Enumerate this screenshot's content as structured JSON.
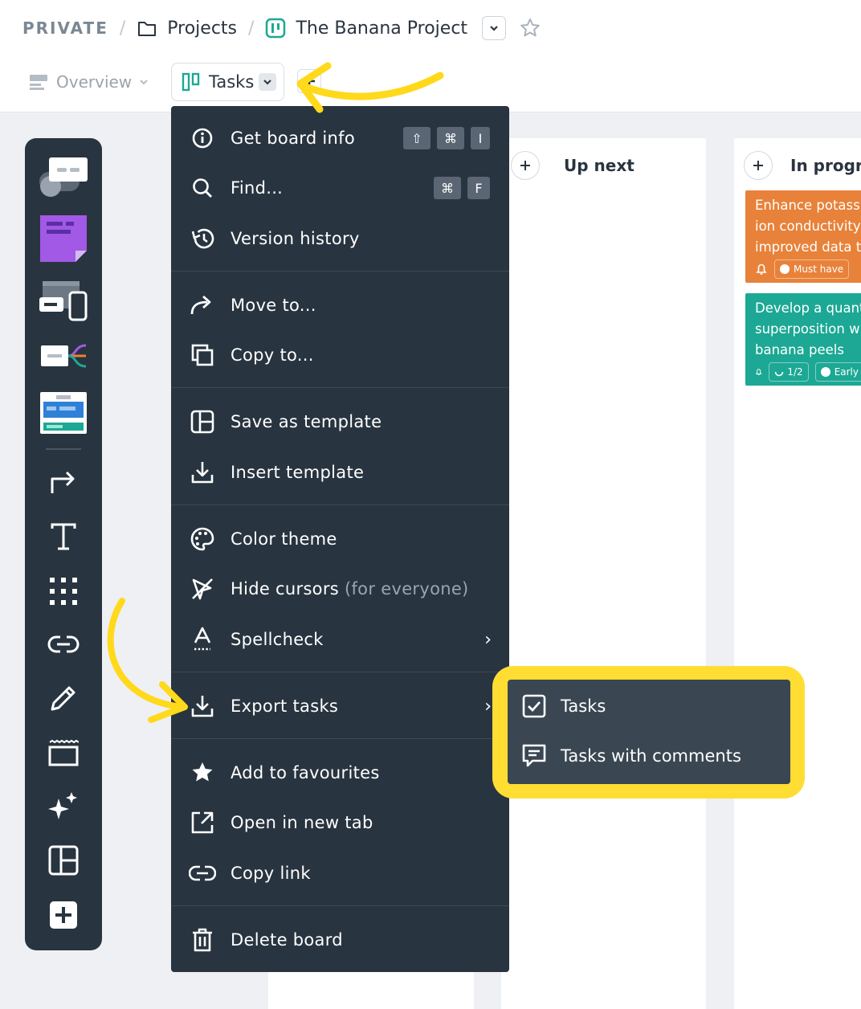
{
  "breadcrumb": {
    "workspace": "PRIVATE",
    "separator": "/",
    "folder": "Projects",
    "board": "The Banana Project"
  },
  "views": {
    "overview": "Overview",
    "tasks": "Tasks",
    "add": "+"
  },
  "columns": [
    {
      "title": "Up next"
    },
    {
      "title": "In progre"
    }
  ],
  "cards": [
    {
      "lines": [
        "Enhance potassi",
        "ion conductivity",
        "improved data tr"
      ],
      "tag": "Must have",
      "color": "#e8823a"
    },
    {
      "lines": [
        "Develop a quant",
        "superposition w",
        "banana peels"
      ],
      "progress": "1/2",
      "tag": "Early",
      "color": "#1ca894"
    }
  ],
  "menu": {
    "items": [
      {
        "label": "Get board info",
        "icon": "info-icon",
        "keys": [
          "⇧",
          "⌘",
          "I"
        ]
      },
      {
        "label": "Find...",
        "icon": "search-icon",
        "keys": [
          "⌘",
          "F"
        ]
      },
      {
        "label": "Version history",
        "icon": "history-icon"
      },
      {
        "label": "Move to...",
        "icon": "move-arrow-icon"
      },
      {
        "label": "Copy to...",
        "icon": "copy-icon"
      },
      {
        "label": "Save as template",
        "icon": "template-icon"
      },
      {
        "label": "Insert template",
        "icon": "insert-download-icon"
      },
      {
        "label": "Color theme",
        "icon": "palette-icon"
      },
      {
        "label": "Hide cursors",
        "suffix": "(for everyone)",
        "icon": "hide-cursor-icon"
      },
      {
        "label": "Spellcheck",
        "icon": "spellcheck-icon",
        "chevron": "›"
      },
      {
        "label": "Export tasks",
        "icon": "export-download-icon",
        "chevron": "›"
      },
      {
        "label": "Add to favourites",
        "icon": "star-filled-icon"
      },
      {
        "label": "Open in new tab",
        "icon": "external-link-icon"
      },
      {
        "label": "Copy link",
        "icon": "link-icon"
      },
      {
        "label": "Delete board",
        "icon": "trash-icon"
      }
    ]
  },
  "submenu": {
    "items": [
      {
        "label": "Tasks",
        "icon": "checkbox-icon"
      },
      {
        "label": "Tasks with comments",
        "icon": "comment-icon"
      }
    ]
  },
  "colors": {
    "menu_bg": "#28343f",
    "submenu_bg": "#3a4752",
    "highlight": "#ffdd33",
    "brand_teal": "#1ca894",
    "card_orange": "#e8823a"
  }
}
